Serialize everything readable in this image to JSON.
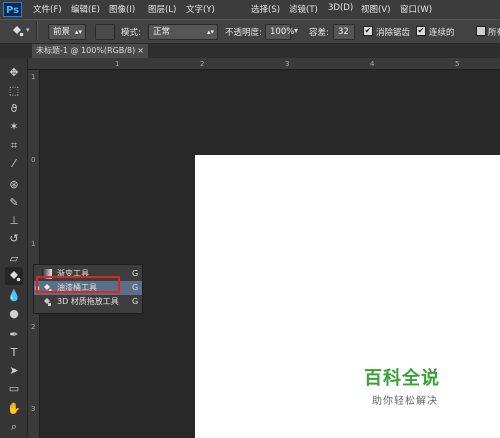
{
  "menubar": {
    "logo": "Ps",
    "items": [
      "文件(F)",
      "编辑(E)",
      "图像(I)",
      "图层(L)",
      "文字(Y)",
      "选择(S)",
      "滤镜(T)",
      "3D(D)",
      "视图(V)",
      "窗口(W)"
    ]
  },
  "options": {
    "fill_source": "前景",
    "mode_label": "模式:",
    "mode_value": "正常",
    "opacity_label": "不透明度:",
    "opacity_value": "100%",
    "tolerance_label": "容差:",
    "tolerance_value": "32",
    "antialias_label": "消除锯齿",
    "contiguous_label": "连续的",
    "all_layers_label": "所有图层"
  },
  "tab": {
    "title": "未标题-1 @ 100%(RGB/8)",
    "close": "×"
  },
  "rulers": {
    "top_ticks": [
      "1",
      "2",
      "3",
      "4",
      "5"
    ],
    "left_ticks": [
      "1",
      "0",
      "1",
      "2",
      "3"
    ]
  },
  "flyout": {
    "items": [
      {
        "label": "渐变工具",
        "key": "G"
      },
      {
        "label": "油漆桶工具",
        "key": "G"
      },
      {
        "label": "3D 材质拖放工具",
        "key": "G"
      }
    ]
  },
  "watermark": {
    "title": "百科全说",
    "subtitle": "助你轻松解决"
  },
  "colors": {
    "accent_highlight": "#e02424",
    "watermark_green": "#3aa138"
  }
}
